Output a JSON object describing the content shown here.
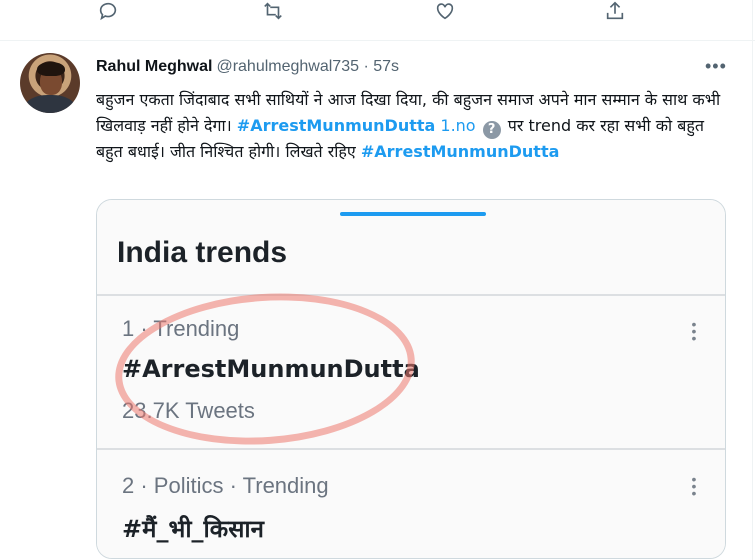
{
  "prev_tweet_actions": {
    "icons": [
      "reply-icon",
      "retweet-icon",
      "like-icon",
      "share-icon"
    ]
  },
  "tweet": {
    "author_name": "Rahul Meghwal",
    "handle_time": "@rahulmeghwal735 · 57s",
    "more": "•••",
    "text_part1": "बहुजन एकता जिंदाबाद सभी साथियों ने आज दिखा दिया, की बहुजन समाज अपने मान सम्मान के साथ कभी खिलवाड़ नहीं होने देगा। ",
    "hashtag1": "#ArrestMunmunDutta",
    "link_1no": "1.no",
    "qmark": "?",
    "text_part2": " पर trend कर रहा सभी को बहुत बहुत बधाई। जीत निश्चित होगी। लिखते रहिए ",
    "hashtag2": "#ArrestMunmunDutta"
  },
  "card": {
    "title": "India trends",
    "trends": [
      {
        "meta": "1 · Trending",
        "name": "#ArrestMunmunDutta",
        "count": "23.7K Tweets"
      },
      {
        "meta": "2 · Politics · Trending",
        "name": "#मैं_भी_किसान"
      }
    ]
  },
  "colors": {
    "accent": "#1d9bf0",
    "muted": "#536471",
    "annotation_circle": "#ec786e"
  }
}
